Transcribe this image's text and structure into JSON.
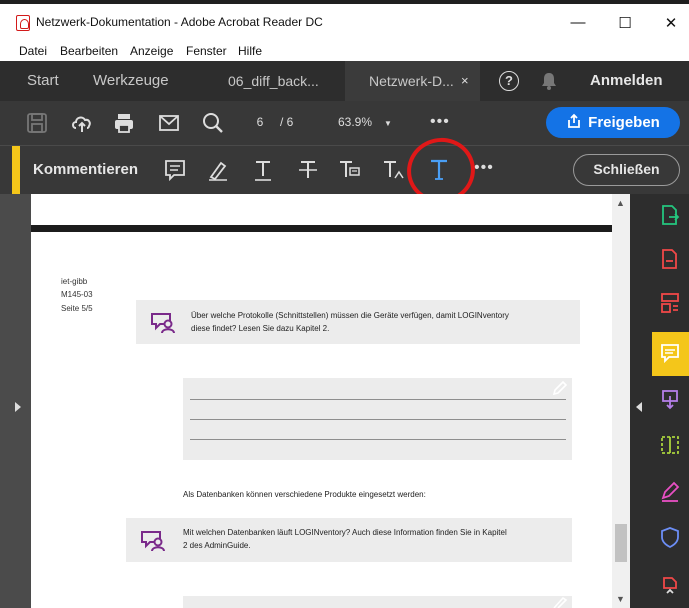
{
  "window": {
    "title": "Netzwerk-Dokumentation - Adobe Acrobat Reader DC",
    "controls": {
      "minimize": "—",
      "maximize": "☐",
      "close": "✕"
    }
  },
  "menubar": {
    "items": [
      "Datei",
      "Bearbeiten",
      "Anzeige",
      "Fenster",
      "Hilfe"
    ]
  },
  "tabs": {
    "home": "Start",
    "tools": "Werkzeuge",
    "doc1": "06_diff_back...",
    "doc2": "Netzwerk-D...",
    "close": "×",
    "help": "?",
    "signin": "Anmelden"
  },
  "toolbar": {
    "page_current": "6",
    "page_total": "/ 6",
    "zoom": "63.9%",
    "more": "•••",
    "share_label": "Freigeben"
  },
  "commentbar": {
    "label": "Kommentieren",
    "more": "•••",
    "close_label": "Schließen",
    "accent_color": "#f4c61a",
    "highlight_color": "#e01818"
  },
  "document": {
    "header_lines": [
      "iet-gibb",
      "M145-03",
      "Seite 5/5"
    ],
    "comment1": {
      "line1": "Über welche Protokolle (Schnittstellen) müssen die Geräte verfügen, damit LOGINventory",
      "line2": "diese findet? Lesen Sie dazu Kapitel 2."
    },
    "middle_text": "Als Datenbanken können verschiedene Produkte eingesetzt werden:",
    "comment2": {
      "line1": "Mit welchen Datenbanken läuft LOGINventory? Auch diese Information finden Sie in Kapitel",
      "line2": "2 des AdminGuide."
    },
    "icon_color": "#7a2a8a"
  },
  "rightpane": {
    "tools": [
      "export-pdf-icon",
      "create-pdf-icon",
      "organize-pages-icon",
      "comment-tool-icon",
      "compress-icon",
      "edit-pdf-icon",
      "fill-sign-icon",
      "protect-icon",
      "more-tools-icon"
    ]
  }
}
